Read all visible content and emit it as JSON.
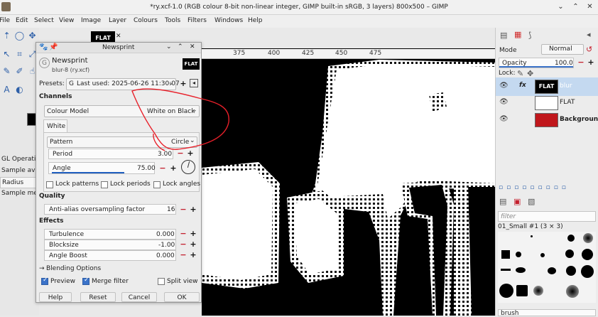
{
  "window": {
    "title": "*ry.xcf-1.0 (RGB colour 8-bit non-linear integer, GIMP built-in sRGB, 3 layers) 800x500 – GIMP",
    "minimize": "⌄",
    "maximize": "⌃",
    "close": "✕"
  },
  "menu": [
    "File",
    "Edit",
    "Select",
    "View",
    "Image",
    "Layer",
    "Colours",
    "Tools",
    "Filters",
    "Windows",
    "Help"
  ],
  "tool_options": {
    "op": "GL Operatio",
    "sample": "Sample ave",
    "radius": "Radius",
    "merged": "Sample me"
  },
  "image_tab": {
    "thumb_label": "FLAT",
    "close": "✕"
  },
  "ruler": {
    "ticks": [
      "375",
      "400",
      "425",
      "450",
      "475"
    ]
  },
  "dialog": {
    "title": "Newsprint",
    "filter_name": "Newsprint",
    "filter_sub": "blur-8 (ry.xcf)",
    "thumb": "FLAT",
    "presets_label": "Presets:",
    "presets_value": "Last used: 2025-06-26 11:30:07",
    "channels_heading": "Channels",
    "colour_model_label": "Colour Model",
    "colour_model_value": "White on Black",
    "tab_white": "White",
    "pattern_label": "Pattern",
    "pattern_value": "Circle",
    "period_label": "Period",
    "period_value": "3.00",
    "angle_label": "Angle",
    "angle_value": "75.00",
    "lock_patterns": "Lock patterns",
    "lock_periods": "Lock periods",
    "lock_angles": "Lock angles",
    "quality_heading": "Quality",
    "antialias_label": "Anti-alias oversampling factor",
    "antialias_value": "16",
    "effects_heading": "Effects",
    "turbulence_label": "Turbulence",
    "turbulence_value": "0.000",
    "blocksize_label": "Blocksize",
    "blocksize_value": "-1.00",
    "angle_boost_label": "Angle Boost",
    "angle_boost_value": "0.000",
    "blending_options": "Blending Options",
    "preview_label": "Preview",
    "merge_filter_label": "Merge filter",
    "split_view_label": "Split view",
    "preview_checked": true,
    "merge_checked": true,
    "split_checked": false,
    "help_btn": "Help",
    "reset_btn": "Reset",
    "cancel_btn": "Cancel",
    "ok_btn": "OK"
  },
  "layers": {
    "mode_label": "Mode",
    "mode_value": "Normal",
    "opacity_label": "Opacity",
    "opacity_value": "100.0",
    "lock_label": "Lock:",
    "items": [
      {
        "name": "blur",
        "thumb_text": "FLAT",
        "fx": "fx",
        "selected": true
      },
      {
        "name": "FLAT",
        "thumb_text": "",
        "fx": "",
        "selected": false
      },
      {
        "name": "Background",
        "thumb_text": "",
        "fx": "",
        "selected": false
      }
    ]
  },
  "brushes": {
    "filter_placeholder": "filter",
    "brush_set": "01_Small #1 (3 × 3)",
    "bottom_label": "brush"
  },
  "colors": {
    "accent": "#3b73c9",
    "annotation_red": "#e8202a",
    "background_layer": "#c0171c",
    "selected_row": "#c4d9f0"
  }
}
